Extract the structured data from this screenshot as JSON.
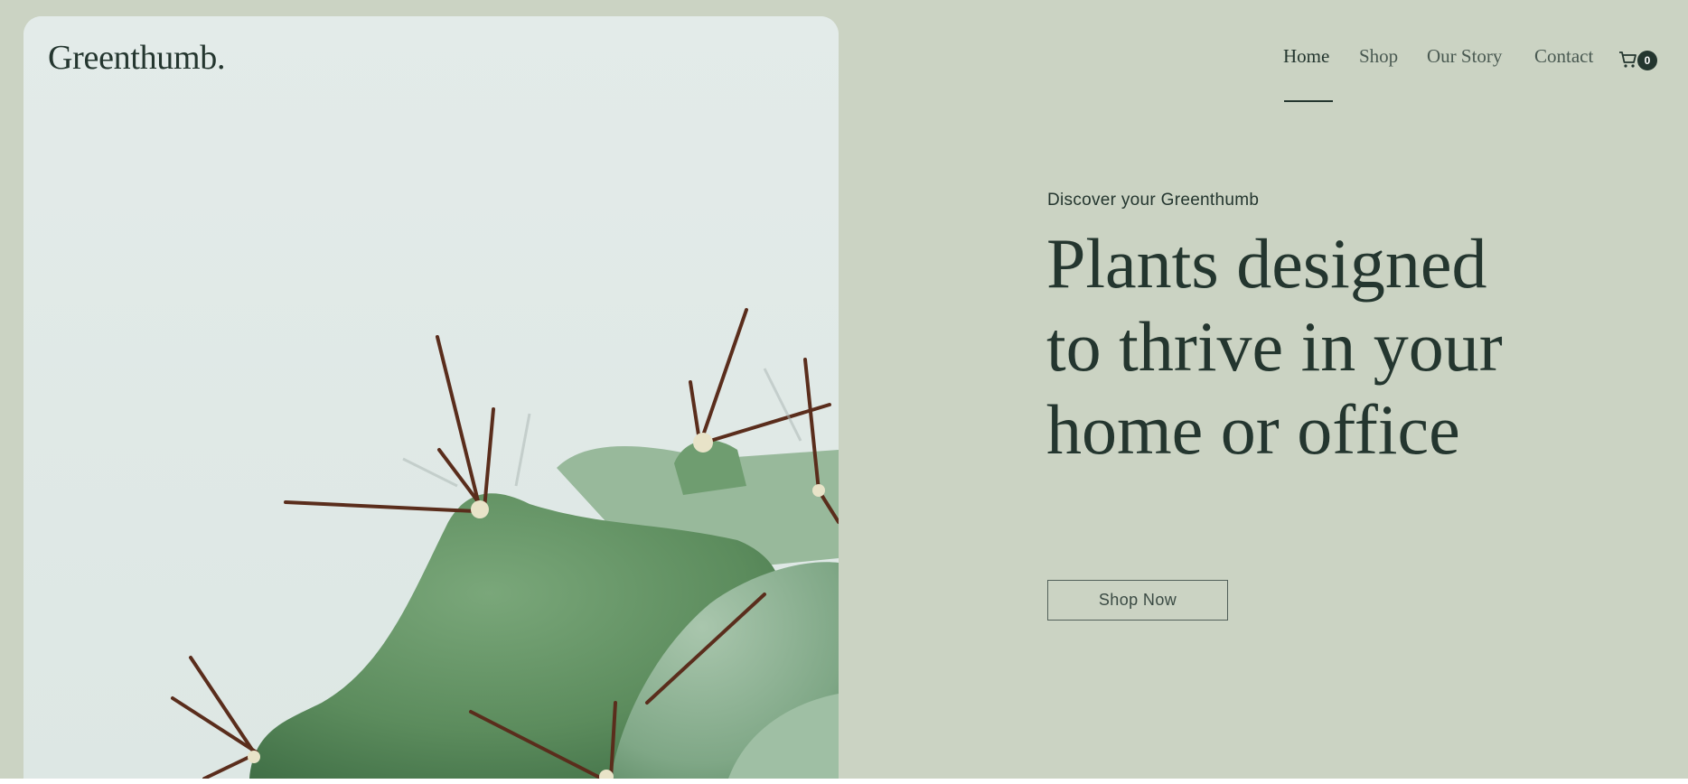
{
  "brand": {
    "logo": "Greenthumb."
  },
  "nav": {
    "items": [
      {
        "label": "Home",
        "active": true
      },
      {
        "label": "Shop",
        "active": false
      },
      {
        "label": "Our Story",
        "active": false
      },
      {
        "label": "Contact",
        "active": false
      }
    ],
    "cart": {
      "icon": "cart-icon",
      "count": "0"
    }
  },
  "hero": {
    "eyebrow": "Discover your Greenthumb",
    "headline": "Plants designed to thrive in your home or office",
    "cta_label": "Shop Now",
    "image": {
      "subject": "cactus-photo"
    }
  },
  "colors": {
    "background": "#cbd3c3",
    "text": "#24362f",
    "image_sky": "#e2eae8",
    "cactus_green": "#5f8f5f"
  }
}
